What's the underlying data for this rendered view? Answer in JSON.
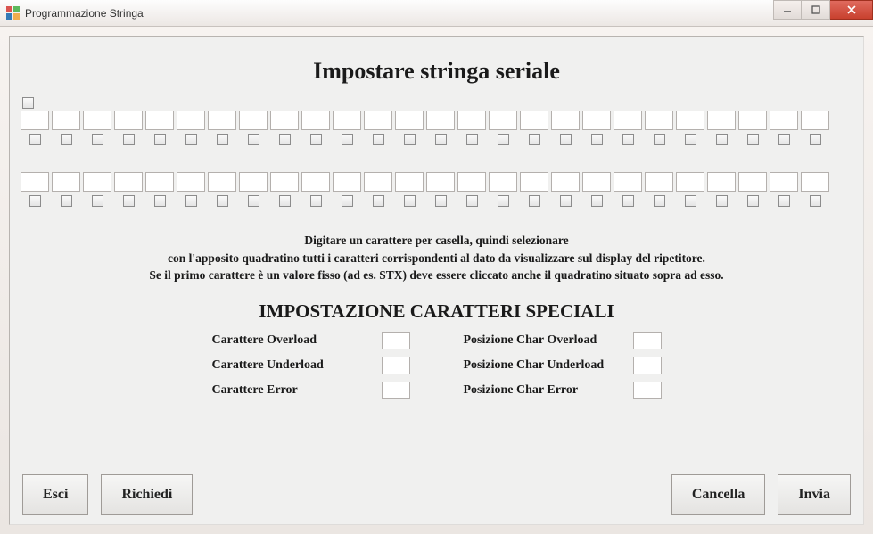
{
  "window": {
    "title": "Programmazione Stringa"
  },
  "header": "Impostare stringa seriale",
  "cells_row1_count": 26,
  "cells_row2_count": 26,
  "instructions": {
    "line1": "Digitare un carattere per casella,  quindi selezionare",
    "line2": "con l'apposito quadratino tutti i caratteri corrispondenti al dato da visualizzare sul display del ripetitore.",
    "line3": "Se il primo carattere è un valore fisso (ad es. STX) deve essere cliccato anche il quadratino situato sopra ad esso."
  },
  "subheader": "IMPOSTAZIONE CARATTERI SPECIALI",
  "special": {
    "left": [
      {
        "label": "Carattere Overload"
      },
      {
        "label": "Carattere Underload"
      },
      {
        "label": "Carattere Error"
      }
    ],
    "right": [
      {
        "label": "Posizione Char Overload"
      },
      {
        "label": "Posizione Char Underload"
      },
      {
        "label": "Posizione Char Error"
      }
    ]
  },
  "buttons": {
    "esci": "Esci",
    "richiedi": "Richiedi",
    "cancella": "Cancella",
    "invia": "Invia"
  }
}
